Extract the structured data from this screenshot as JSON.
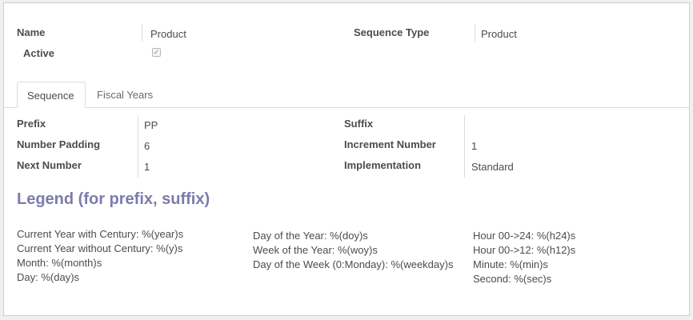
{
  "header": {
    "name_label": "Name",
    "name_value": "Product",
    "active_label": "Active",
    "active_checked": true,
    "sequence_type_label": "Sequence Type",
    "sequence_type_value": "Product"
  },
  "tabs": [
    {
      "label": "Sequence",
      "active": true
    },
    {
      "label": "Fiscal Years",
      "active": false
    }
  ],
  "sequence": {
    "prefix_label": "Prefix",
    "prefix_value": "PP",
    "number_padding_label": "Number Padding",
    "number_padding_value": "6",
    "next_number_label": "Next Number",
    "next_number_value": "1",
    "suffix_label": "Suffix",
    "suffix_value": "",
    "increment_label": "Increment Number",
    "increment_value": "1",
    "implementation_label": "Implementation",
    "implementation_value": "Standard"
  },
  "legend": {
    "title": "Legend (for prefix, suffix)",
    "col1": [
      "Current Year with Century: %(year)s",
      "Current Year without Century: %(y)s",
      "Month: %(month)s",
      "Day: %(day)s"
    ],
    "col2": [
      "Day of the Year: %(doy)s",
      "Week of the Year: %(woy)s",
      "Day of the Week (0:Monday): %(weekday)s"
    ],
    "col3": [
      "Hour 00->24: %(h24)s",
      "Hour 00->12: %(h12)s",
      "Minute: %(min)s",
      "Second: %(sec)s"
    ]
  },
  "colors": {
    "legend_title": "#7c7bad",
    "text": "#4c4c4c",
    "border": "#dddddd"
  }
}
